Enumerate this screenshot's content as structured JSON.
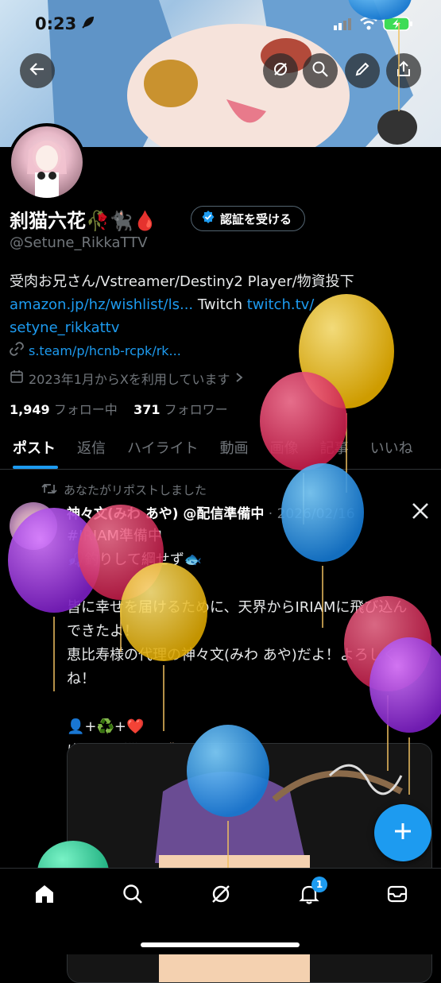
{
  "status_bar": {
    "time": "0:23",
    "battery_icon": "battery-charging-icon"
  },
  "header": {
    "back_icon": "arrow-left-icon",
    "actions": [
      "grok-icon",
      "search-icon",
      "edit-icon",
      "share-icon"
    ]
  },
  "profile": {
    "name": "刹猫六花🥀🐈‍⬛🩸",
    "verify_label": "認証を受ける",
    "handle": "@Setune_RikkaTTV",
    "bio_text": "受肉お兄さん/Vstreamer/Destiny2 Player/物資投下",
    "bio_link1": "amazon.jp/hz/wishlist/ls...",
    "bio_mid": " Twitch ",
    "bio_link2": "twitch.tv/",
    "bio_link3": "setyne_rikkattv",
    "website": "s.team/p/hcnb-rcpk/rk...",
    "joined": "2023年1月からXを利用しています",
    "following_count": "1,949",
    "following_label": "フォロー中",
    "followers_count": "371",
    "followers_label": "フォロワー"
  },
  "tabs": [
    "ポスト",
    "返信",
    "ハイライト",
    "動画",
    "画像",
    "記事",
    "いいね"
  ],
  "post": {
    "repost_label": "あなたがリポストしました",
    "author_name": "神々文(みわ あや) @配信準備中",
    "date": "· 2026/02/16",
    "source_icon": "x-logo-icon",
    "text": "#IRIAM準備中\n🎣釣りして綱せず🐟\n\n皆に幸せを届けるために、天界からIRIAMに飛び込んできたよ！\n恵比寿様の代理の神々文(みわ あや)だよ！よろしくね！\n\n👤+♻️+❤️\nゆっくり巡回…🐌"
  },
  "fab_icon": "plus-icon",
  "bottom_nav": {
    "items": [
      "home-icon",
      "search-icon",
      "grok-icon",
      "notifications-icon",
      "messages-icon"
    ],
    "notification_badge": "1"
  },
  "colors": {
    "accent": "#1d9bf0",
    "background": "#000000",
    "muted": "#71767b"
  }
}
